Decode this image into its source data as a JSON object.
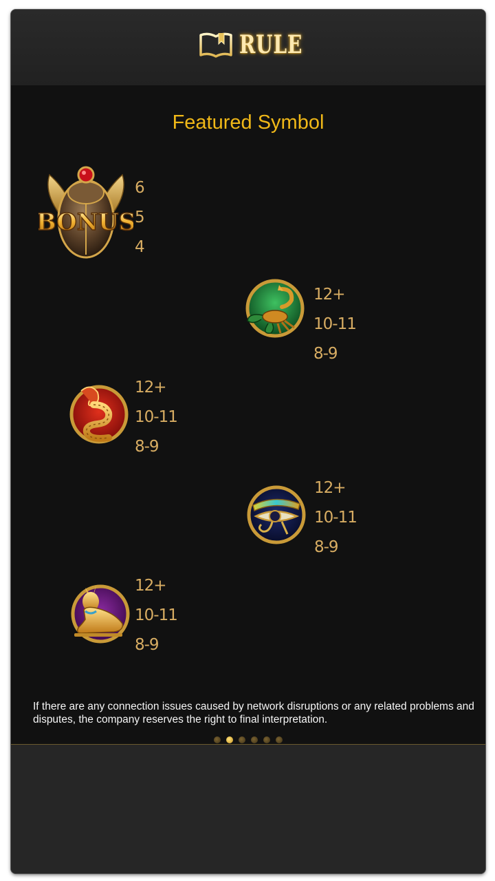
{
  "header": {
    "title": "RULE",
    "icon": "book-icon"
  },
  "section": {
    "title": "Featured Symbol"
  },
  "symbols": [
    {
      "name": "bonus-scarab",
      "icon": "bonus-scarab-icon",
      "label": "BONUS",
      "payouts": [
        "6",
        "5",
        "4"
      ]
    },
    {
      "name": "scorpion",
      "icon": "scorpion-icon",
      "payouts": [
        "12+",
        "10-11",
        "8-9"
      ]
    },
    {
      "name": "cobra",
      "icon": "cobra-icon",
      "payouts": [
        "12+",
        "10-11",
        "8-9"
      ]
    },
    {
      "name": "eye-of-horus",
      "icon": "eye-of-horus-icon",
      "payouts": [
        "12+",
        "10-11",
        "8-9"
      ]
    },
    {
      "name": "bastet-cat",
      "icon": "bastet-cat-icon",
      "payouts": [
        "12+",
        "10-11",
        "8-9"
      ]
    }
  ],
  "disclaimer": "If there are any connection issues caused by network disruptions or any related problems and disputes, the company reserves the right to final interpretation.",
  "pagination": {
    "total": 6,
    "current": 2
  },
  "colors": {
    "title": "#f0b818",
    "payout": "#d8ad63",
    "background": "#111111",
    "frame": "#262626"
  }
}
